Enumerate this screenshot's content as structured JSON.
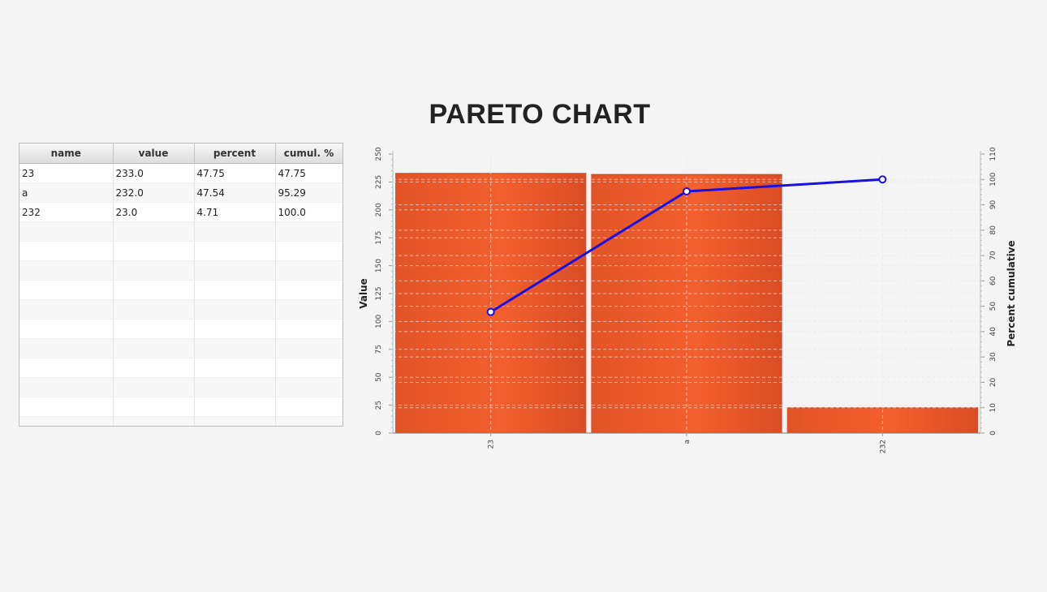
{
  "title": "PARETO CHART",
  "table": {
    "columns": [
      "name",
      "value",
      "percent",
      "cumul. %"
    ],
    "rows": [
      [
        "23",
        "233.0",
        "47.75",
        "47.75"
      ],
      [
        "a",
        "232.0",
        "47.54",
        "95.29"
      ],
      [
        "232",
        "23.0",
        "4.71",
        "100.0"
      ]
    ]
  },
  "chart_data": {
    "type": "bar",
    "title": "PARETO CHART",
    "categories": [
      "23",
      "a",
      "232"
    ],
    "series": [
      {
        "values": [
          233,
          232,
          23
        ],
        "axis": "left",
        "type": "bar",
        "color": "#f05a28"
      },
      {
        "values": [
          47.75,
          95.29,
          100.0
        ],
        "axis": "right",
        "type": "line",
        "color": "#1a10e0"
      }
    ],
    "ylabel": "Value",
    "y2label": "Percent cumulative",
    "ylim": [
      0,
      250
    ],
    "yticks": [
      0,
      25,
      50,
      75,
      100,
      125,
      150,
      175,
      200,
      225,
      250
    ],
    "y2lim": [
      0,
      110
    ],
    "y2ticks": [
      0,
      10,
      20,
      30,
      40,
      50,
      60,
      70,
      80,
      90,
      100,
      110
    ],
    "grid": true,
    "legend": "none"
  }
}
